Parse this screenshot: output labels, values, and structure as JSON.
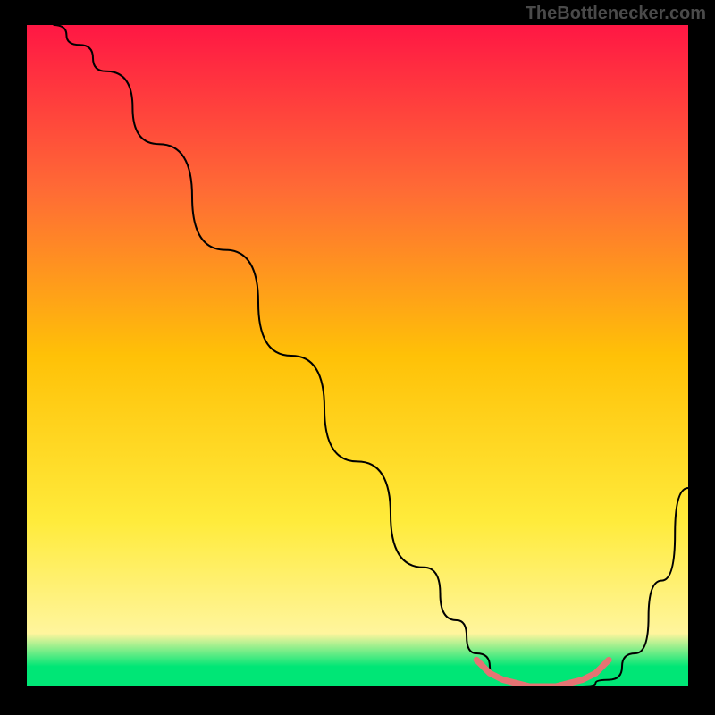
{
  "watermark": "TheBottlenecker.com",
  "chart_data": {
    "type": "line",
    "title": "",
    "xlabel": "",
    "ylabel": "",
    "xlim": [
      0,
      100
    ],
    "ylim": [
      0,
      100
    ],
    "gradient_stops": [
      {
        "offset": 0,
        "color": "#ff1744"
      },
      {
        "offset": 25,
        "color": "#ff6b35"
      },
      {
        "offset": 50,
        "color": "#ffc107"
      },
      {
        "offset": 75,
        "color": "#ffeb3b"
      },
      {
        "offset": 92,
        "color": "#fff59d"
      },
      {
        "offset": 97,
        "color": "#00e676"
      },
      {
        "offset": 100,
        "color": "#00e676"
      }
    ],
    "series": [
      {
        "name": "bottleneck-curve",
        "color": "#000000",
        "x": [
          4,
          8,
          12,
          20,
          30,
          40,
          50,
          60,
          65,
          68,
          72,
          76,
          80,
          84,
          88,
          92,
          96,
          100
        ],
        "y": [
          100,
          97,
          93,
          82,
          66,
          50,
          34,
          18,
          10,
          5,
          1,
          0,
          0,
          0,
          1,
          5,
          16,
          30
        ]
      },
      {
        "name": "optimal-zone",
        "color": "#e57373",
        "thick": true,
        "x": [
          68,
          70,
          72,
          74,
          76,
          78,
          80,
          82,
          84,
          86,
          88
        ],
        "y": [
          4,
          2,
          1,
          0.5,
          0,
          0,
          0,
          0.5,
          1,
          2,
          4
        ]
      }
    ]
  }
}
